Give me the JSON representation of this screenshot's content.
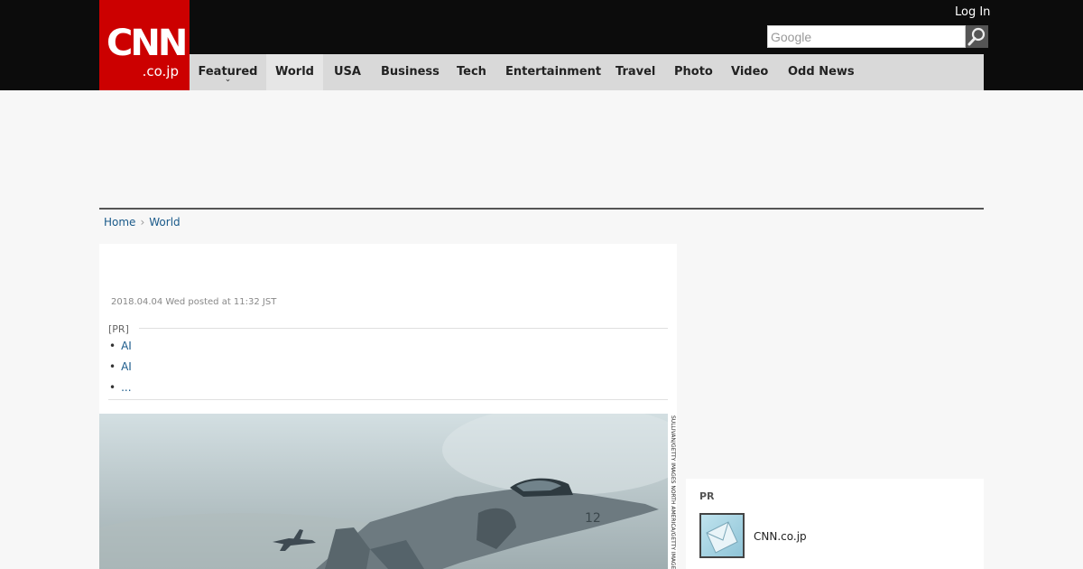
{
  "header": {
    "logo_text": "CNN",
    "logo_sub": ".co.jp",
    "login_label": "Log In",
    "search_placeholder": "Google",
    "brand_color": "#cc0000"
  },
  "nav": {
    "items": [
      {
        "label": "Featured",
        "has_dropdown": true
      },
      {
        "label": "World",
        "active": true
      },
      {
        "label": "USA"
      },
      {
        "label": "Business"
      },
      {
        "label": "Tech"
      },
      {
        "label": "Entertainment"
      },
      {
        "label": "Travel"
      },
      {
        "label": "Photo"
      },
      {
        "label": "Video"
      },
      {
        "label": "Odd News"
      }
    ],
    "dropdown_icon": "chevron-down-icon"
  },
  "breadcrumb": {
    "items": [
      "Home",
      "World"
    ],
    "separator_icon": "chevron-right-icon"
  },
  "article": {
    "posted": "2018.04.04 Wed posted at 11:32 JST",
    "pr_label": "[PR]",
    "pr_links": [
      "AI",
      "AI",
      "..."
    ],
    "photo_credit": "SULLIVAN/GETTY IMAGES NORTH AMERICA/GETTY IMAGES",
    "photo_subject": "Harrier jet aircraft"
  },
  "sidebar": {
    "pr_heading": "PR",
    "pr_item_name": "CNN.co.jp"
  }
}
